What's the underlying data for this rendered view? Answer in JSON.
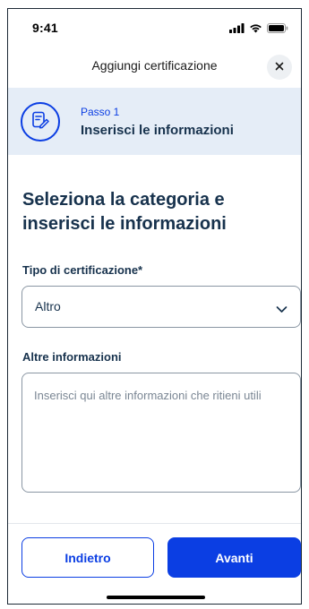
{
  "status_bar": {
    "time": "9:41",
    "icons": [
      "signal-icon",
      "wifi-icon",
      "battery-icon"
    ]
  },
  "header": {
    "title": "Aggiungi certificazione",
    "close_icon": "close-icon"
  },
  "step": {
    "number_label": "Passo 1",
    "title": "Inserisci le informazioni",
    "icon": "document-edit-icon"
  },
  "main": {
    "heading": "Seleziona la categoria e inserisci le informazioni",
    "certification_type": {
      "label": "Tipo di certificazione*",
      "selected_value": "Altro"
    },
    "additional_info": {
      "label": "Altre informazioni",
      "value": "",
      "placeholder": "Inserisci qui altre informazioni che ritieni utili"
    }
  },
  "footer": {
    "back_label": "Indietro",
    "next_label": "Avanti"
  },
  "colors": {
    "primary": "#0b3ee3",
    "banner_bg": "#e5edf7",
    "text_dark": "#17324d",
    "border": "#8a96a3"
  }
}
